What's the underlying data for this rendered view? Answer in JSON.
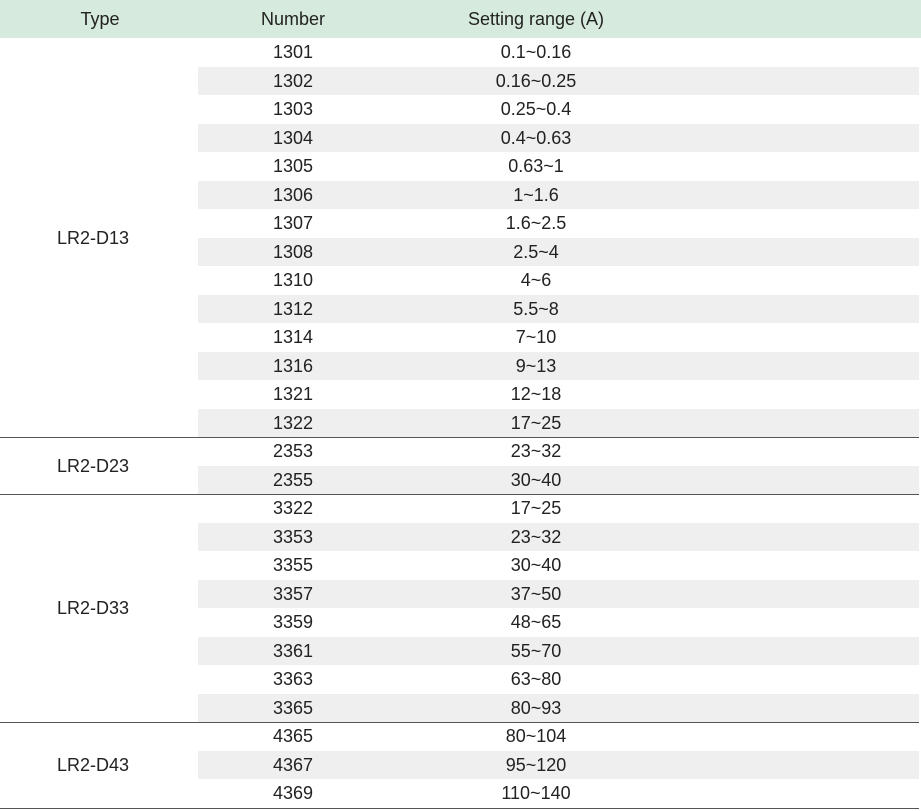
{
  "headers": {
    "type": "Type",
    "number": "Number",
    "range": "Setting range (A)"
  },
  "groups": [
    {
      "type": "LR2-D13",
      "rows": [
        {
          "number": "1301",
          "range": "0.1~0.16"
        },
        {
          "number": "1302",
          "range": "0.16~0.25"
        },
        {
          "number": "1303",
          "range": "0.25~0.4"
        },
        {
          "number": "1304",
          "range": "0.4~0.63"
        },
        {
          "number": "1305",
          "range": "0.63~1"
        },
        {
          "number": "1306",
          "range": "1~1.6"
        },
        {
          "number": "1307",
          "range": "1.6~2.5"
        },
        {
          "number": "1308",
          "range": "2.5~4"
        },
        {
          "number": "1310",
          "range": "4~6"
        },
        {
          "number": "1312",
          "range": "5.5~8"
        },
        {
          "number": "1314",
          "range": "7~10"
        },
        {
          "number": "1316",
          "range": "9~13"
        },
        {
          "number": "1321",
          "range": "12~18"
        },
        {
          "number": "1322",
          "range": "17~25"
        }
      ]
    },
    {
      "type": "LR2-D23",
      "rows": [
        {
          "number": "2353",
          "range": "23~32"
        },
        {
          "number": "2355",
          "range": "30~40"
        }
      ]
    },
    {
      "type": "LR2-D33",
      "rows": [
        {
          "number": "3322",
          "range": "17~25"
        },
        {
          "number": "3353",
          "range": "23~32"
        },
        {
          "number": "3355",
          "range": "30~40"
        },
        {
          "number": "3357",
          "range": "37~50"
        },
        {
          "number": "3359",
          "range": "48~65"
        },
        {
          "number": "3361",
          "range": "55~70"
        },
        {
          "number": "3363",
          "range": "63~80"
        },
        {
          "number": "3365",
          "range": "80~93"
        }
      ]
    },
    {
      "type": "LR2-D43",
      "rows": [
        {
          "number": "4365",
          "range": "80~104"
        },
        {
          "number": "4367",
          "range": "95~120"
        },
        {
          "number": "4369",
          "range": "110~140"
        }
      ]
    }
  ]
}
